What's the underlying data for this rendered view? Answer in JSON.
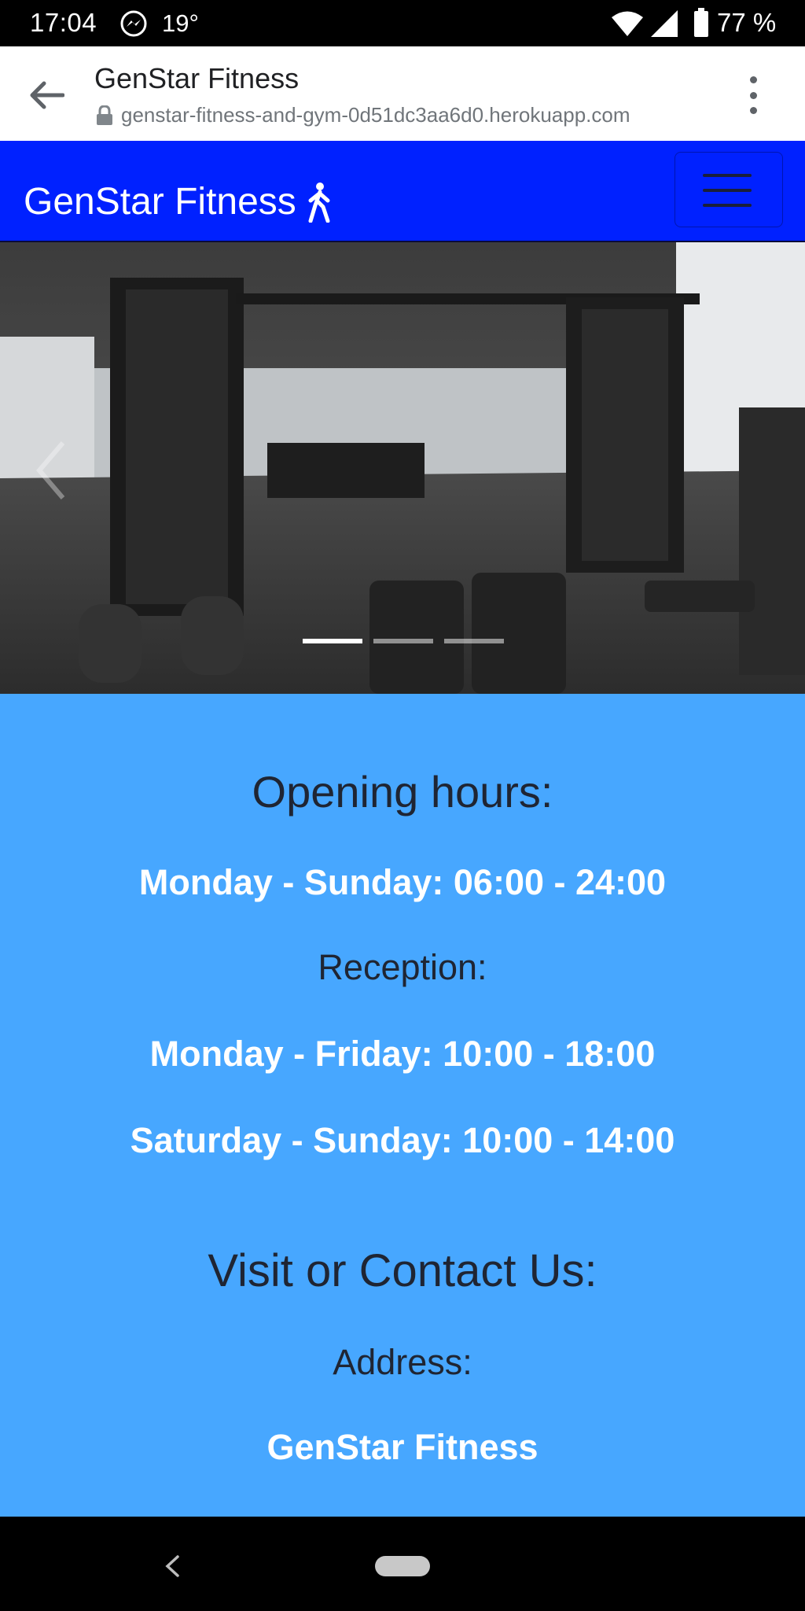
{
  "status_bar": {
    "time": "17:04",
    "temperature": "19°",
    "battery": "77 %",
    "icons": [
      "messenger-icon",
      "wifi-icon",
      "signal-icon",
      "battery-icon"
    ]
  },
  "browser": {
    "page_title": "GenStar Fitness",
    "url": "genstar-fitness-and-gym-0d51dc3aa6d0.herokuapp.com",
    "icons": [
      "back-arrow-icon",
      "lock-icon",
      "more-vert-icon"
    ]
  },
  "navbar": {
    "brand": "GenStar Fitness",
    "brand_icon": "walking-person-icon",
    "background": "#0021ff",
    "toggler_icon": "hamburger-menu-icon"
  },
  "carousel": {
    "image_description_icon": "gym-photo",
    "slide_count": 3,
    "active_slide": 1
  },
  "content": {
    "background": "#47a7ff",
    "opening_heading": "Opening hours:",
    "opening_line": "Monday - Sunday: 06:00 - 24:00",
    "reception_heading": "Reception:",
    "reception_weekday": "Monday - Friday: 10:00 - 18:00",
    "reception_weekend": "Saturday - Sunday: 10:00 - 14:00",
    "contact_heading": "Visit or Contact Us:",
    "address_heading": "Address:",
    "address_name": "GenStar Fitness"
  }
}
